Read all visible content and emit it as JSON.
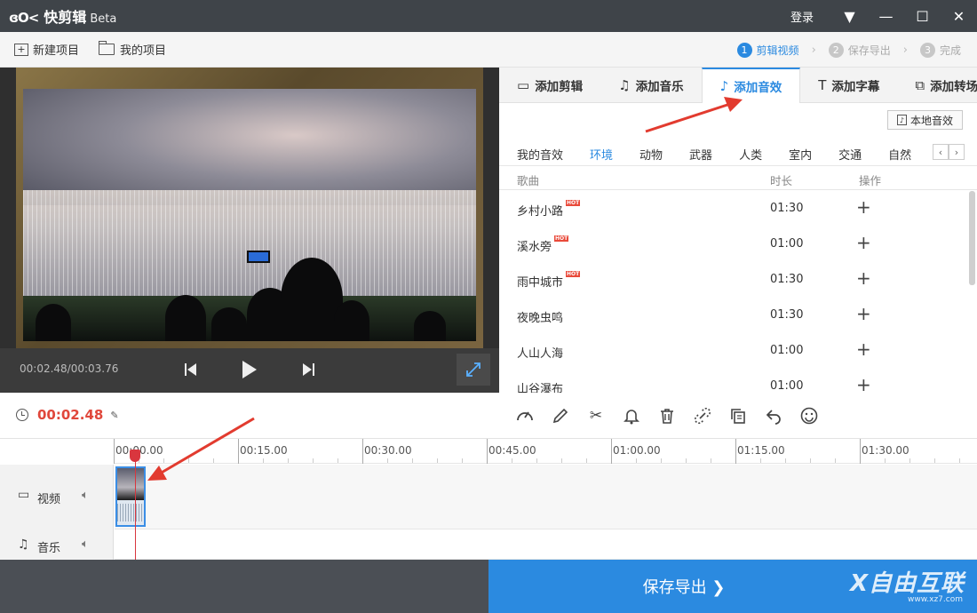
{
  "app": {
    "logo_mark": "ɞΟ<",
    "name": "快剪辑",
    "edition": "Beta"
  },
  "titlebar": {
    "login": "登录"
  },
  "toolbar": {
    "new_project": "新建项目",
    "my_projects": "我的项目",
    "steps": [
      {
        "num": "1",
        "label": "剪辑视频"
      },
      {
        "num": "2",
        "label": "保存导出"
      },
      {
        "num": "3",
        "label": "完成"
      }
    ]
  },
  "preview": {
    "timecode": "00:02.48/00:03.76"
  },
  "panel": {
    "tabs": [
      "添加剪辑",
      "添加音乐",
      "添加音效",
      "添加字幕",
      "添加转场"
    ],
    "active_tab": "添加音效",
    "local_button": "本地音效",
    "categories": [
      "我的音效",
      "环境",
      "动物",
      "武器",
      "人类",
      "室内",
      "交通",
      "自然"
    ],
    "active_category": "环境",
    "columns": {
      "song": "歌曲",
      "duration": "时长",
      "action": "操作"
    },
    "rows": [
      {
        "name": "乡村小路",
        "hot": "HOT",
        "duration": "01:30"
      },
      {
        "name": "溪水旁",
        "hot": "HOT",
        "duration": "01:00"
      },
      {
        "name": "雨中城市",
        "hot": "HOT",
        "duration": "01:30"
      },
      {
        "name": "夜晚虫鸣",
        "hot": "",
        "duration": "01:30"
      },
      {
        "name": "人山人海",
        "hot": "",
        "duration": "01:00"
      },
      {
        "name": "山谷瀑布",
        "hot": "",
        "duration": "01:00"
      }
    ]
  },
  "editor": {
    "current_time": "00:02.48"
  },
  "timeline": {
    "ruler": [
      "00:00.00",
      "00:15.00",
      "00:30.00",
      "00:45.00",
      "01:00.00",
      "01:15.00",
      "01:30.00"
    ],
    "tracks": {
      "video": "视频",
      "music": "音乐"
    }
  },
  "export": {
    "label": "保存导出 ❯"
  },
  "watermark": {
    "text": "X自由互联",
    "sub": "www.xz7.com"
  },
  "colors": {
    "accent": "#2b8ae0",
    "time_red": "#e0473b",
    "annotation": "#e23b2f"
  }
}
